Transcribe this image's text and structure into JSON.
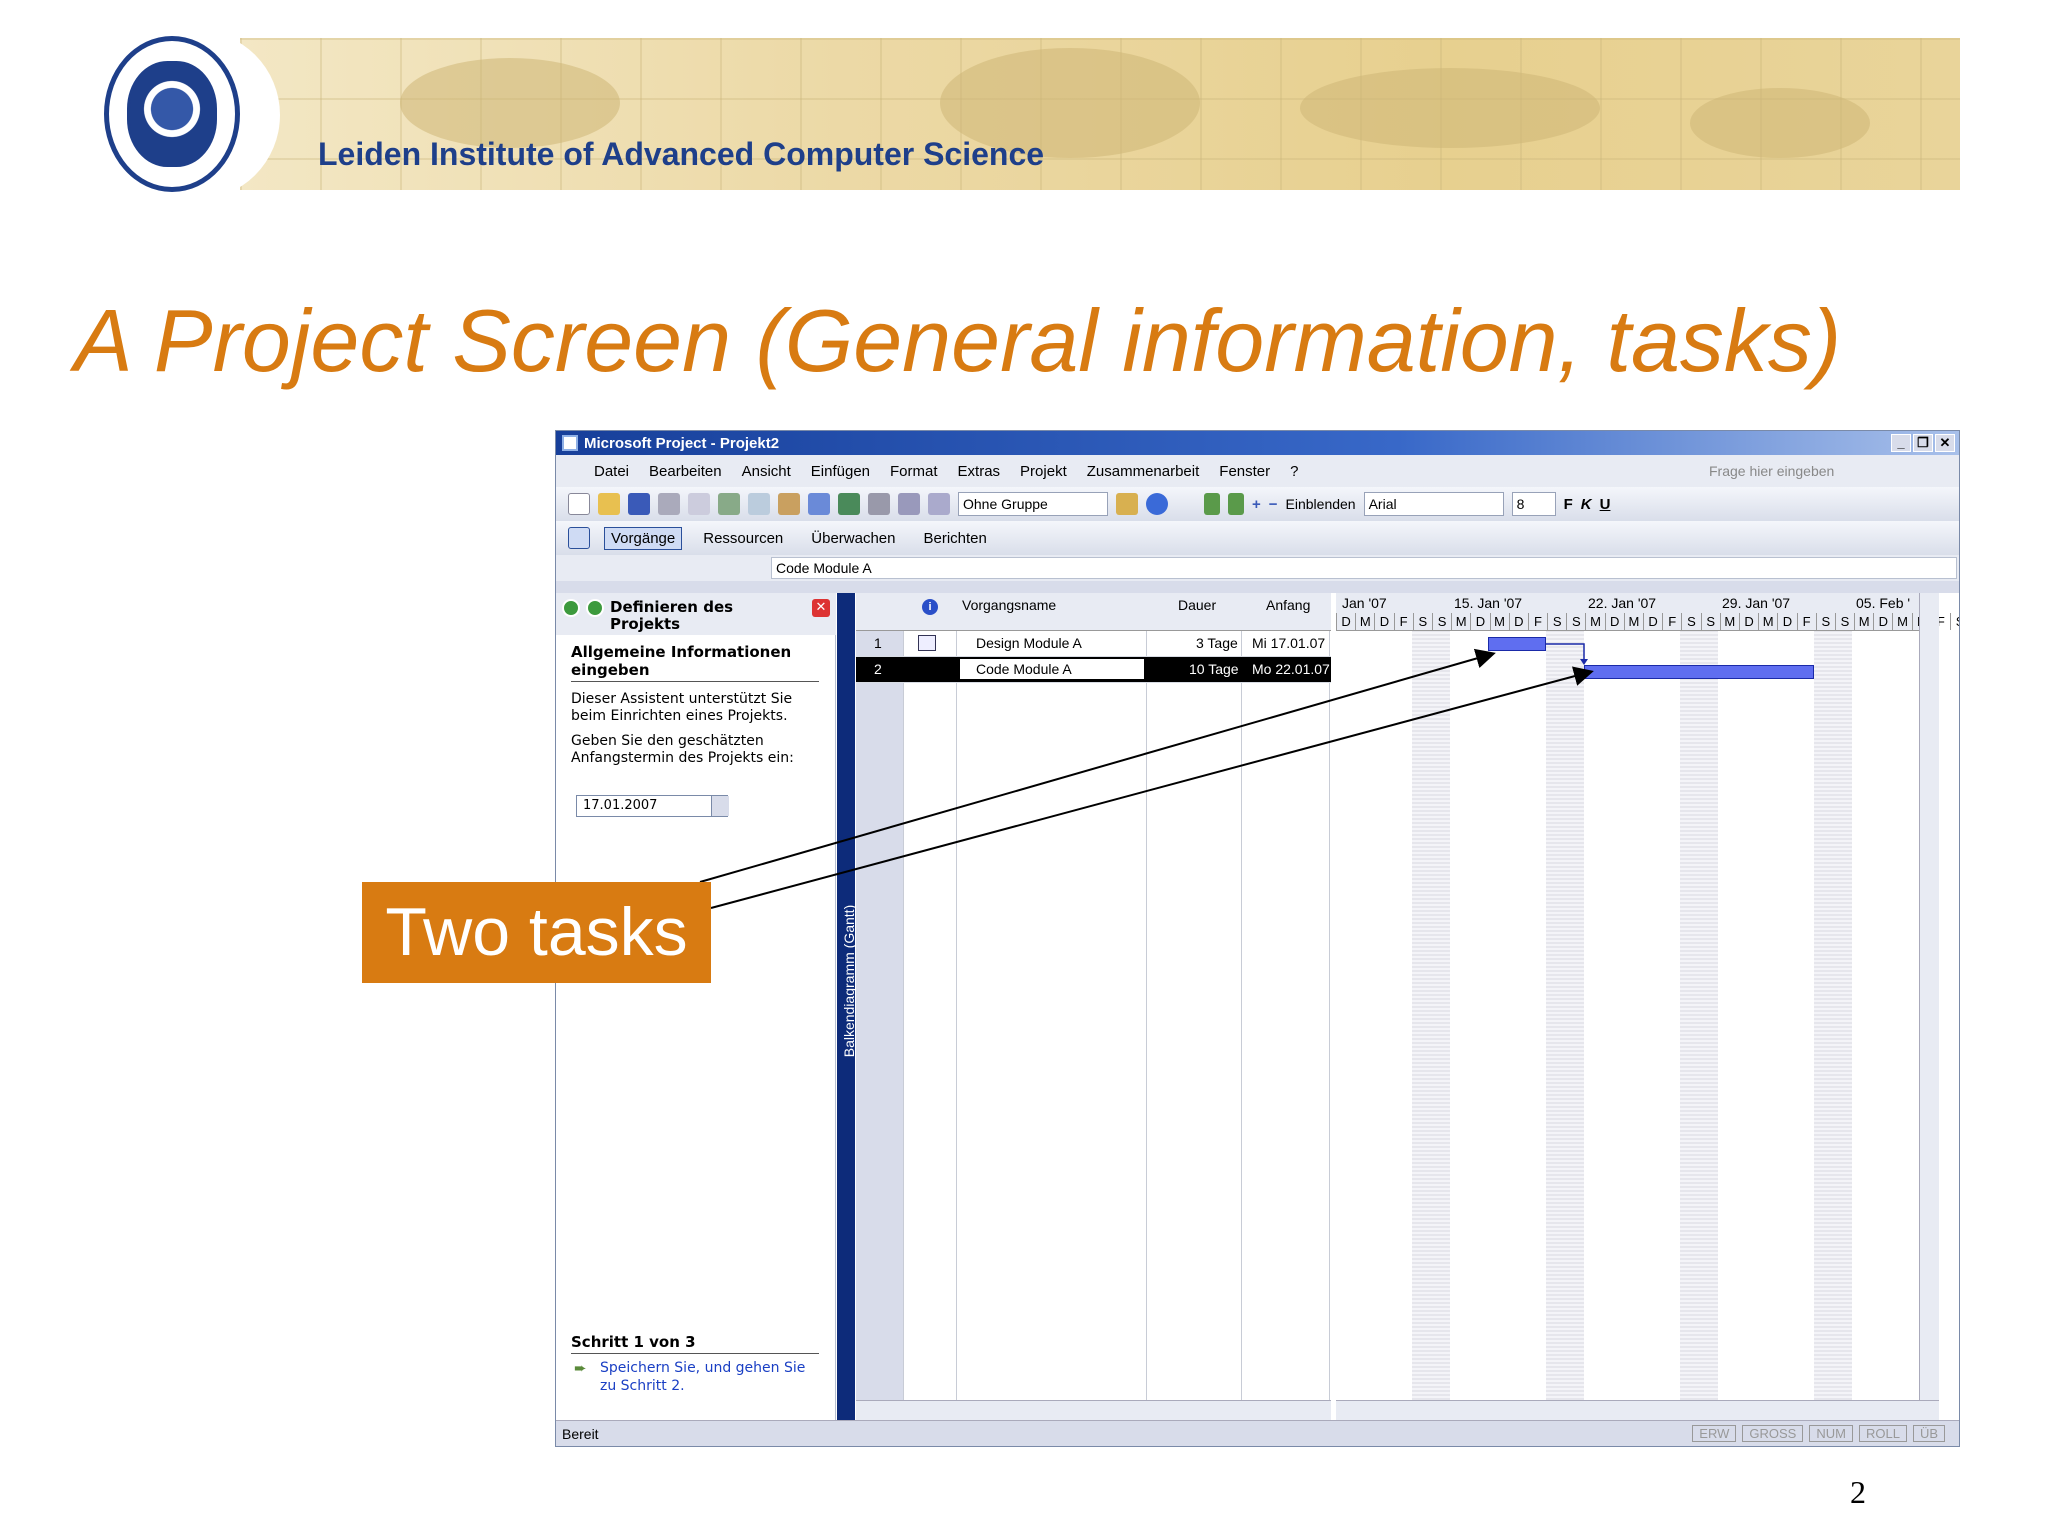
{
  "header": {
    "institute": "Leiden Institute of Advanced Computer Science"
  },
  "slide": {
    "title": "A Project Screen (General information, tasks)",
    "page_number": "2",
    "callout": "Two tasks"
  },
  "window": {
    "title": "Microsoft Project - Projekt2",
    "menu": [
      "Datei",
      "Bearbeiten",
      "Ansicht",
      "Einfügen",
      "Format",
      "Extras",
      "Projekt",
      "Zusammenarbeit",
      "Fenster",
      "?"
    ],
    "ask_placeholder": "Frage hier eingeben",
    "toolbar": {
      "group_select": "Ohne Gruppe",
      "show_label": "Einblenden",
      "font": "Arial",
      "font_size": "8",
      "bold": "F",
      "italic": "K",
      "underline": "U"
    },
    "toolbar2": [
      "Vorgänge",
      "Ressourcen",
      "Überwachen",
      "Berichten"
    ],
    "entry_value": "Code Module A"
  },
  "task_pane": {
    "header": "Definieren des Projekts",
    "subtitle": "Allgemeine Informationen eingeben",
    "text1": "Dieser Assistent unterstützt Sie beim Einrichten eines Projekts.",
    "text2": "Geben Sie den geschätzten Anfangstermin des Projekts ein:",
    "date_value": "17.01.2007",
    "step": "Schritt 1 von 3",
    "link": "Speichern Sie, und gehen Sie zu Schritt 2."
  },
  "view_label": "Balkendiagramm (Gantt)",
  "table": {
    "headers": {
      "name": "Vorgangsname",
      "duration": "Dauer",
      "start": "Anfang"
    },
    "rows": [
      {
        "id": "1",
        "name": "Design Module A",
        "duration": "3 Tage",
        "start": "Mi 17.01.07"
      },
      {
        "id": "2",
        "name": "Code Module A",
        "duration": "10 Tage",
        "start": "Mo 22.01.07"
      }
    ]
  },
  "gantt": {
    "weeks": [
      "Jan '07",
      "15. Jan '07",
      "22. Jan '07",
      "29. Jan '07",
      "05. Feb '"
    ],
    "days": [
      "D",
      "M",
      "D",
      "F",
      "S",
      "S",
      "M",
      "D",
      "M",
      "D",
      "F",
      "S",
      "S",
      "M",
      "D",
      "M",
      "D",
      "F",
      "S",
      "S",
      "M",
      "D",
      "M",
      "D",
      "F",
      "S",
      "S",
      "M",
      "D",
      "M",
      "D",
      "F",
      "S",
      "S",
      "M",
      "D",
      "M"
    ]
  },
  "status": {
    "ready": "Bereit",
    "indicators": [
      "ERW",
      "GROSS",
      "NUM",
      "ROLL",
      "ÜB"
    ]
  },
  "colors": {
    "title": "#d87b12",
    "institute": "#1e3f8a",
    "bar": "#5f6ef0"
  }
}
